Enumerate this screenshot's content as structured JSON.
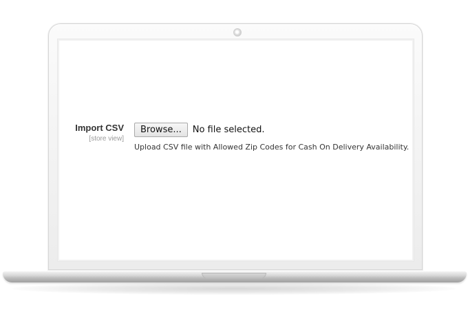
{
  "form": {
    "label": "Import CSV",
    "scope": "[store view]",
    "browse_button_label": "Browse...",
    "file_status": "No file selected.",
    "help_text": "Upload CSV file with Allowed Zip Codes for Cash On Delivery Availability."
  },
  "device": {
    "frame_color": "#f3f3f3",
    "base_color": "#c0c0c0"
  }
}
